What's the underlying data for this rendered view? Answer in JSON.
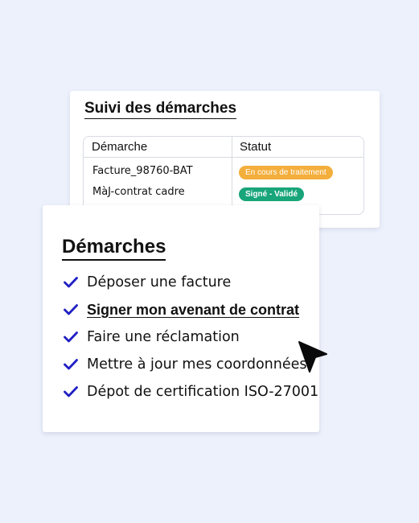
{
  "suivi": {
    "title": "Suivi des démarches",
    "columns": [
      "Démarche",
      "Statut"
    ],
    "rows": [
      {
        "demarche": "Facture_98760-BAT",
        "statut": "En cours de traitement",
        "statut_color": "#f3ae3c"
      },
      {
        "demarche": "MàJ-contrat cadre",
        "statut": "Signé - Validé",
        "statut_color": "#18a57a"
      }
    ]
  },
  "demarches": {
    "title": "Démarches",
    "check_color": "#1f1fc4",
    "items": [
      {
        "label": "Déposer une facture",
        "icon": "check-icon"
      },
      {
        "label": "Signer mon avenant de contrat",
        "icon": "check-icon",
        "active": true
      },
      {
        "label": "Faire une réclamation",
        "icon": "check-icon"
      },
      {
        "label": "Mettre à jour mes coordonnées",
        "icon": "check-icon"
      },
      {
        "label": "Dépot de certification ISO-27001",
        "icon": "check-icon"
      }
    ]
  },
  "cursor": {
    "icon": "mouse-pointer-icon"
  }
}
